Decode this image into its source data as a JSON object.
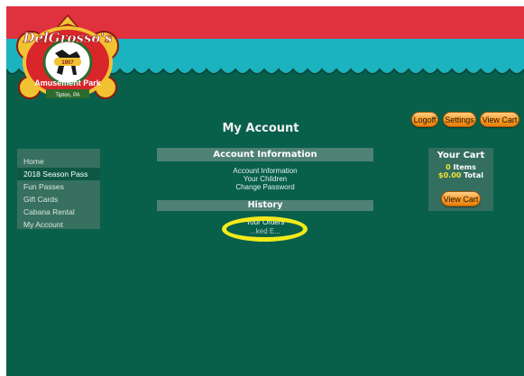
{
  "logo": {
    "name": "DelGrosso's",
    "subtitle": "Amusement Park",
    "location": "Tipton, PA",
    "est": "1907"
  },
  "header_buttons": {
    "logoff": "Logoff",
    "settings": "Settings",
    "view_cart": "View Cart"
  },
  "page_title": "My Account",
  "sidebar": {
    "items": [
      {
        "label": "Home"
      },
      {
        "label": "2018 Season Pass"
      },
      {
        "label": "Fun Passes"
      },
      {
        "label": "Gift Cards"
      },
      {
        "label": "Cabana Rental"
      },
      {
        "label": "My Account"
      }
    ]
  },
  "account_info": {
    "heading": "Account Information",
    "links": [
      "Account Information",
      "Your Children",
      "Change Password"
    ]
  },
  "history": {
    "heading": "History",
    "links": [
      "Your Orders",
      "...ked E..."
    ]
  },
  "cart": {
    "title": "Your Cart",
    "items_count": "0",
    "items_label": "Items",
    "total_amount": "$0.00",
    "total_label": "Total",
    "button": "View Cart"
  },
  "colors": {
    "background": "#08604a",
    "banner_red": "#e0313f",
    "banner_teal": "#1bb3bf",
    "button_orange": "#f59a26",
    "highlight": "#f2ea1b"
  }
}
